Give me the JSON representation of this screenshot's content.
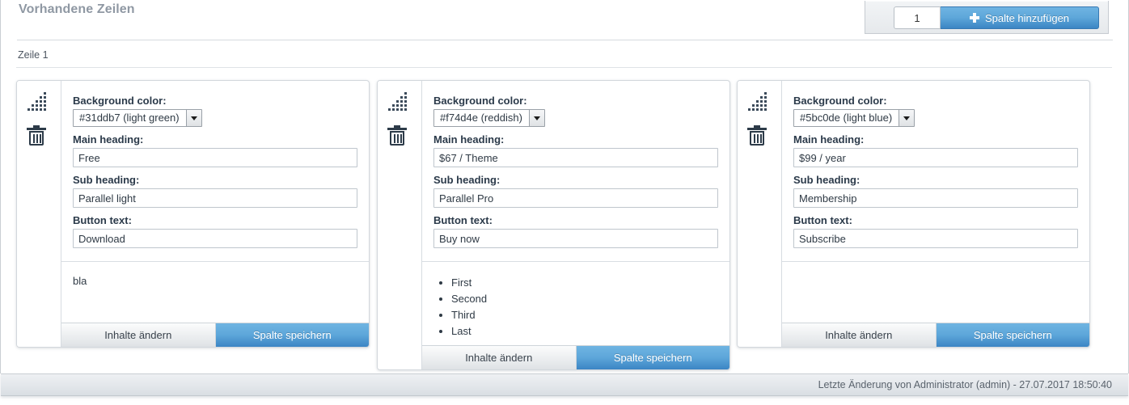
{
  "header": {
    "title": "Vorhandene Zeilen"
  },
  "toolbar": {
    "count_value": "1",
    "count_placeholder": "1",
    "add_button_label": "Spalte hinzufügen",
    "add_icon": "plus-icon"
  },
  "row": {
    "label": "Zeile 1"
  },
  "field_labels": {
    "background_color": "Background color:",
    "main_heading": "Main heading:",
    "sub_heading": "Sub heading:",
    "button_text": "Button text:"
  },
  "footer_buttons": {
    "edit_label": "Inhalte ändern",
    "save_label": "Spalte speichern"
  },
  "icons": {
    "drag": "drag-handle-icon",
    "delete": "trash-icon",
    "select_arrow": "chevron-down-icon"
  },
  "colors": {
    "accent_blue": "#3b85c4",
    "title_gray": "#8f98a3",
    "label_navy": "#2b3a4a",
    "card_border": "#d2d7dc"
  },
  "columns": [
    {
      "background_color": "#31ddb7 (light green)",
      "main_heading": "Free",
      "sub_heading": "Parallel light",
      "button_text": "Download",
      "body_type": "paragraph",
      "body_text": "bla",
      "body_items": []
    },
    {
      "background_color": "#f74d4e (reddish)",
      "main_heading": "$67 / Theme",
      "sub_heading": "Parallel Pro",
      "button_text": "Buy now",
      "body_type": "list",
      "body_text": "",
      "body_items": [
        "First",
        "Second",
        "Third",
        "Last"
      ]
    },
    {
      "background_color": "#5bc0de (light blue)",
      "main_heading": "$99 / year",
      "sub_heading": "Membership",
      "button_text": "Subscribe",
      "body_type": "empty",
      "body_text": "",
      "body_items": []
    }
  ],
  "status": {
    "text": "Letzte Änderung von Administrator (admin) - 27.07.2017 18:50:40"
  }
}
